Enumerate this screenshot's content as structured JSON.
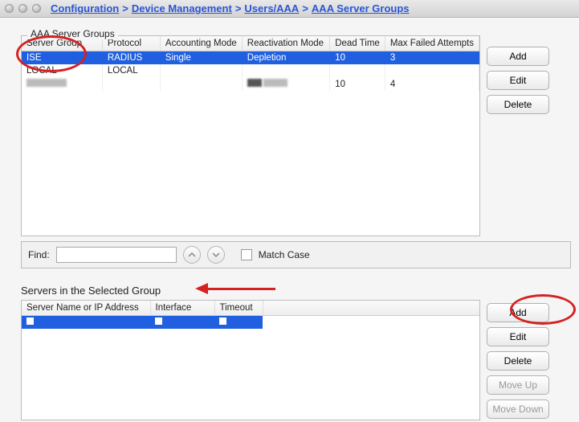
{
  "breadcrumb": {
    "seg1": "Configuration",
    "seg2": "Device Management",
    "seg3": "Users/AAA",
    "seg4": "AAA Server Groups"
  },
  "top": {
    "title": "AAA Server Groups",
    "headers": {
      "h0": "Server Group",
      "h1": "Protocol",
      "h2": "Accounting Mode",
      "h3": "Reactivation Mode",
      "h4": "Dead Time",
      "h5": "Max Failed Attempts"
    },
    "rows": [
      {
        "server_group": "ISE",
        "protocol": "RADIUS",
        "accounting": "Single",
        "reactivation": "Depletion",
        "dead": "10",
        "max": "3"
      },
      {
        "server_group": "LOCAL",
        "protocol": "LOCAL",
        "accounting": "",
        "reactivation": "",
        "dead": "",
        "max": ""
      },
      {
        "server_group": "",
        "protocol": "",
        "accounting": "",
        "reactivation": "",
        "dead": "10",
        "max": "4"
      }
    ],
    "buttons": {
      "add": "Add",
      "edit": "Edit",
      "delete": "Delete"
    }
  },
  "find": {
    "label": "Find:",
    "value": "",
    "match": "Match Case"
  },
  "bottom": {
    "title": "Servers in the Selected Group",
    "headers": {
      "h0": "Server Name or IP Address",
      "h1": "Interface",
      "h2": "Timeout"
    },
    "buttons": {
      "add": "Add",
      "edit": "Edit",
      "delete": "Delete",
      "up": "Move Up",
      "down": "Move Down"
    }
  }
}
